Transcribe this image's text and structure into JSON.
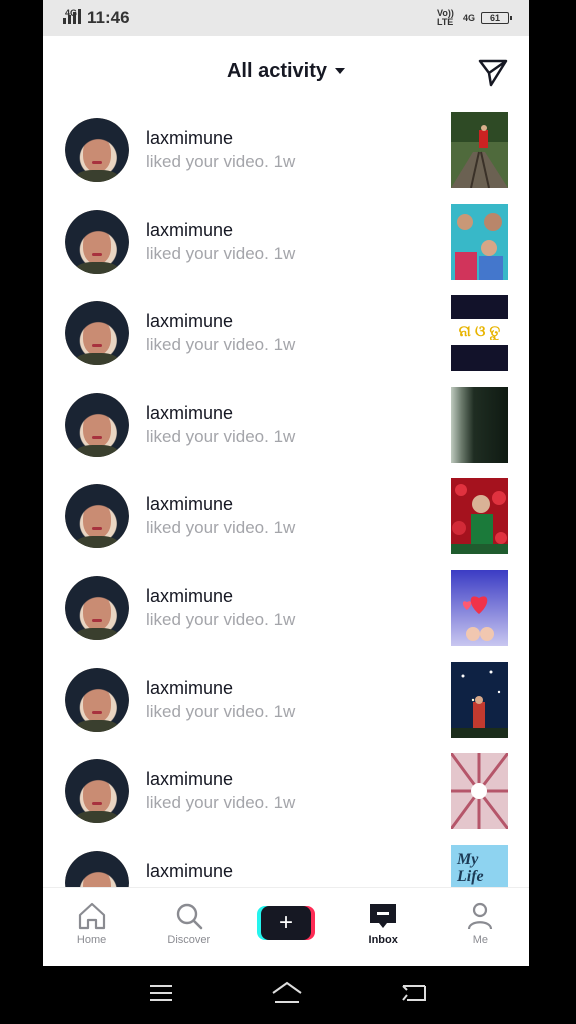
{
  "status_bar": {
    "network": "4G",
    "time": "11:46",
    "volte": "Vo)) LTE",
    "right_net": "4G",
    "battery": "61"
  },
  "header": {
    "title": "All activity"
  },
  "notifications": [
    {
      "username": "laxmimune",
      "action": "liked your video. 1w"
    },
    {
      "username": "laxmimune",
      "action": "liked your video. 1w"
    },
    {
      "username": "laxmimune",
      "action": "liked your video. 1w"
    },
    {
      "username": "laxmimune",
      "action": "liked your video. 1w"
    },
    {
      "username": "laxmimune",
      "action": "liked your video. 1w"
    },
    {
      "username": "laxmimune",
      "action": "liked your video. 1w"
    },
    {
      "username": "laxmimune",
      "action": "liked your video. 1w"
    },
    {
      "username": "laxmimune",
      "action": "liked your video. 1w"
    },
    {
      "username": "laxmimune",
      "action": ""
    }
  ],
  "thumb_texts": {
    "t3": "ନା ଓ ତୁ",
    "t9": "My Life"
  },
  "tabs": [
    {
      "label": "Home",
      "icon": "home-icon"
    },
    {
      "label": "Discover",
      "icon": "search-icon"
    },
    {
      "label": "",
      "icon": "plus-icon"
    },
    {
      "label": "Inbox",
      "icon": "inbox-icon"
    },
    {
      "label": "Me",
      "icon": "person-icon"
    }
  ],
  "colors": {
    "accent_cyan": "#25f4ee",
    "accent_red": "#fe2c55",
    "text": "#161823",
    "muted": "#a4a5aa"
  }
}
